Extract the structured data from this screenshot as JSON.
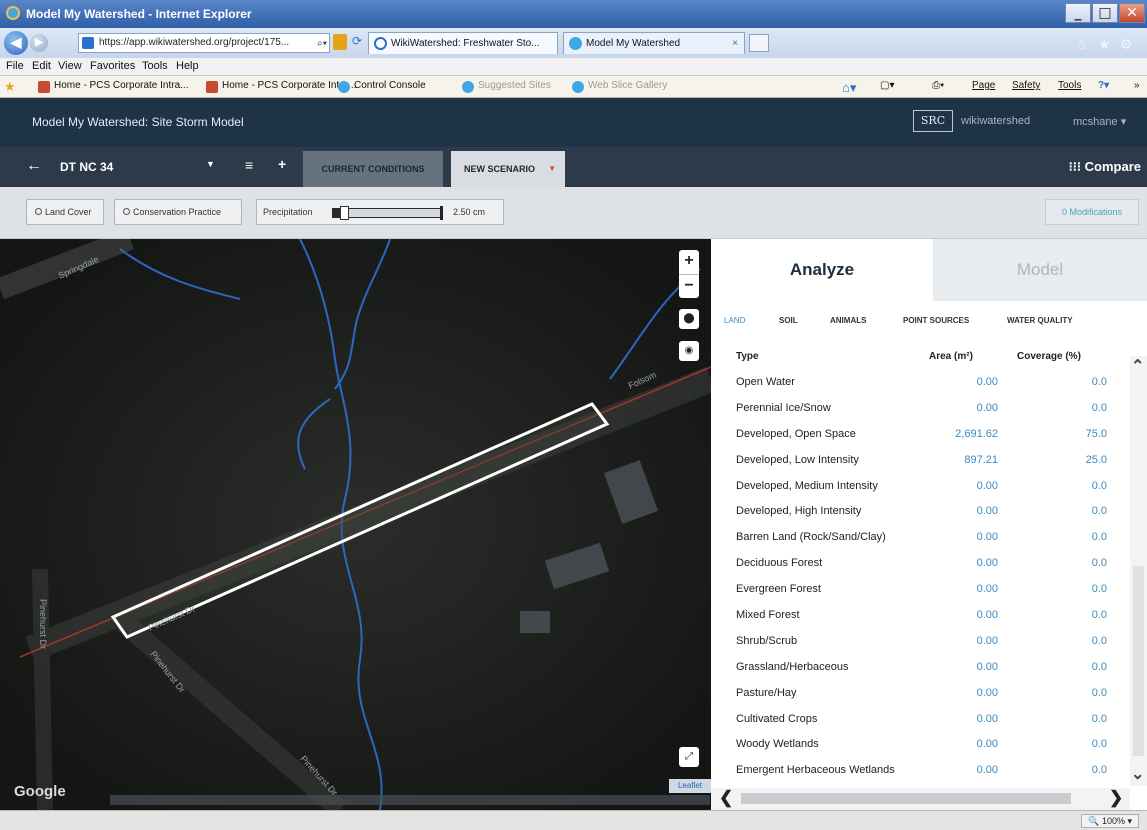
{
  "browser": {
    "window_title": "Model My Watershed - Internet Explorer",
    "address": "https://app.wikiwatershed.org/project/175...",
    "tabs": [
      {
        "label": "WikiWatershed: Freshwater Sto..."
      },
      {
        "label": "Model My Watershed"
      }
    ],
    "menu": [
      "File",
      "Edit",
      "View",
      "Favorites",
      "Tools",
      "Help"
    ],
    "favorites": [
      {
        "label": "Home - PCS Corporate Intra..."
      },
      {
        "label": "Home - PCS Corporate Intra..."
      },
      {
        "label": "Control Console"
      },
      {
        "label": "Suggested Sites"
      },
      {
        "label": "Web Slice Gallery"
      }
    ],
    "commands": [
      "Page",
      "Safety",
      "Tools"
    ],
    "zoom": "100%"
  },
  "app": {
    "title": "Model My Watershed: Site Storm Model",
    "logo_text": "SRC",
    "brand": "wikiwatershed",
    "user": "mcshane"
  },
  "toolbar": {
    "project_name": "DT NC 34",
    "tab_current": "CURRENT CONDITIONS",
    "tab_new": "NEW SCENARIO",
    "compare": "Compare"
  },
  "modifications": {
    "land_cover": "Land Cover",
    "conservation_practice": "Conservation Practice",
    "precip_label": "Precipitation",
    "precip_value": "2.50 cm",
    "precip_fraction": 0.1,
    "mod_count": "0 Modifications"
  },
  "map": {
    "google": "Google",
    "leaflet": "Leaflet",
    "zoom_in": "+",
    "zoom_out": "−"
  },
  "panel": {
    "tab_analyze": "Analyze",
    "tab_model": "Model",
    "subtabs": [
      "LAND",
      "SOIL",
      "ANIMALS",
      "POINT SOURCES",
      "WATER QUALITY"
    ],
    "headers": {
      "type": "Type",
      "area": "Area (m²)",
      "coverage": "Coverage (%)"
    },
    "rows": [
      {
        "type": "Open Water",
        "area": "0.00",
        "coverage": "0.0"
      },
      {
        "type": "Perennial Ice/Snow",
        "area": "0.00",
        "coverage": "0.0"
      },
      {
        "type": "Developed, Open Space",
        "area": "2,691.62",
        "coverage": "75.0"
      },
      {
        "type": "Developed, Low Intensity",
        "area": "897.21",
        "coverage": "25.0"
      },
      {
        "type": "Developed, Medium Intensity",
        "area": "0.00",
        "coverage": "0.0"
      },
      {
        "type": "Developed, High Intensity",
        "area": "0.00",
        "coverage": "0.0"
      },
      {
        "type": "Barren Land (Rock/Sand/Clay)",
        "area": "0.00",
        "coverage": "0.0"
      },
      {
        "type": "Deciduous Forest",
        "area": "0.00",
        "coverage": "0.0"
      },
      {
        "type": "Evergreen Forest",
        "area": "0.00",
        "coverage": "0.0"
      },
      {
        "type": "Mixed Forest",
        "area": "0.00",
        "coverage": "0.0"
      },
      {
        "type": "Shrub/Scrub",
        "area": "0.00",
        "coverage": "0.0"
      },
      {
        "type": "Grassland/Herbaceous",
        "area": "0.00",
        "coverage": "0.0"
      },
      {
        "type": "Pasture/Hay",
        "area": "0.00",
        "coverage": "0.0"
      },
      {
        "type": "Cultivated Crops",
        "area": "0.00",
        "coverage": "0.0"
      },
      {
        "type": "Woody Wetlands",
        "area": "0.00",
        "coverage": "0.0"
      },
      {
        "type": "Emergent Herbaceous Wetlands",
        "area": "0.00",
        "coverage": "0.0"
      }
    ]
  },
  "colors": {
    "header_bg": "#1e3248",
    "toolbar_bg": "#2d3a49",
    "accent_blue": "#3b8bc0",
    "selection_outline": "#ffffff",
    "stream_blue": "#2f6fd6",
    "road_red": "#c0392b"
  }
}
